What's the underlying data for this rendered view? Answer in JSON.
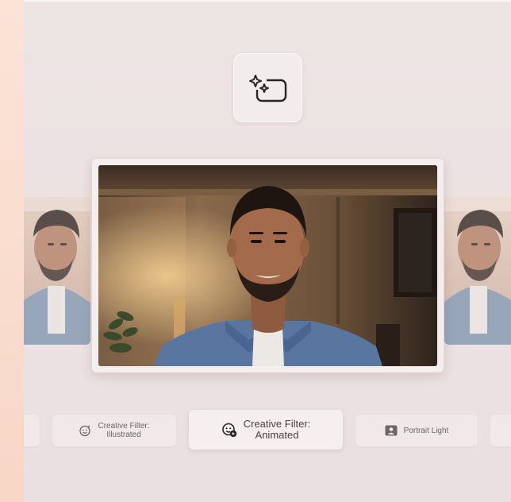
{
  "filters": [
    {
      "line1": "Creative Filter:",
      "line2": "Illustrated",
      "icon": "smiley-sparkle-icon"
    },
    {
      "line1": "Creative Filter:",
      "line2": "Animated",
      "icon": "smiley-play-icon"
    },
    {
      "label": "Portrait Light",
      "icon": "portrait-icon"
    }
  ],
  "hero_icon": "sparkle-image-icon",
  "colors": {
    "accent_strip": "#f9dccd",
    "background": "#ece2e2",
    "chip": "#f1e9e9"
  }
}
